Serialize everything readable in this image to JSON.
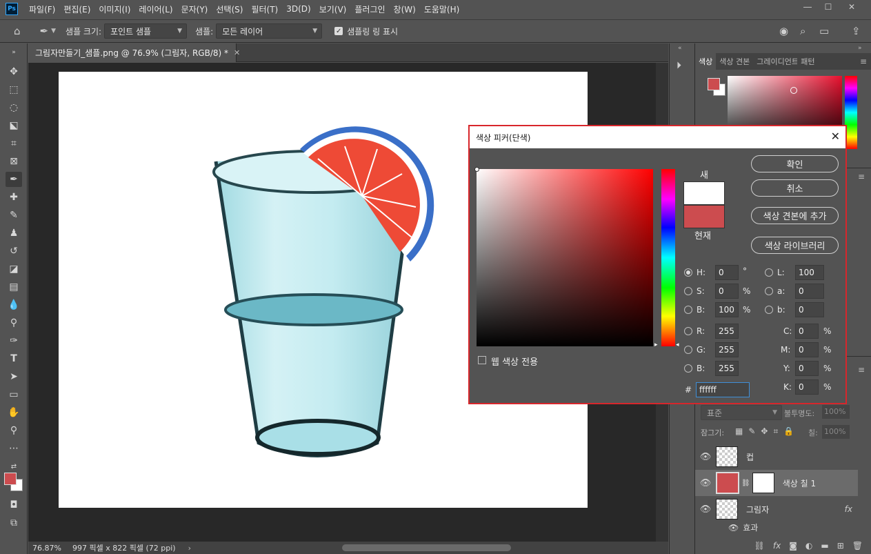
{
  "menu": {
    "logo": "Ps",
    "items": [
      "파일(F)",
      "편집(E)",
      "이미지(I)",
      "레이어(L)",
      "문자(Y)",
      "선택(S)",
      "필터(T)",
      "3D(D)",
      "보기(V)",
      "플러그인",
      "창(W)",
      "도움말(H)"
    ]
  },
  "options": {
    "sample_size_label": "샘플 크기:",
    "sample_size_value": "포인트 샘플",
    "sample_label": "샘플:",
    "sample_value": "모든 레이어",
    "show_ring_label": "샘플링 링 표시"
  },
  "document": {
    "tab_title": "그림자만들기_샘플.png @ 76.9% (그림자, RGB/8) *",
    "zoom": "76.87%",
    "dimensions": "997 픽셀 x 822 픽셀 (72 ppi)"
  },
  "panels": {
    "color_tabs": [
      "색상",
      "색상 견본",
      "그레이디언트",
      "패턴"
    ],
    "blend_mode": "표준",
    "opacity_label": "불투명도:",
    "opacity_value": "100%",
    "lock_label": "잠그기:",
    "fill_label": "칠:",
    "fill_value": "100%",
    "layers": [
      {
        "name": "컵"
      },
      {
        "name": "색상 칠 1"
      },
      {
        "name": "그림자"
      }
    ],
    "effects_label": "효과"
  },
  "dialog": {
    "title": "색상 피커(단색)",
    "new_label": "새",
    "current_label": "현재",
    "ok": "확인",
    "cancel": "취소",
    "add_swatch": "색상 견본에 추가",
    "color_library": "색상 라이브러리",
    "web_only": "웹 색상 전용",
    "fields": {
      "H": "0",
      "S": "0",
      "B": "100",
      "R": "255",
      "G": "255",
      "B2": "255",
      "L": "100",
      "a": "0",
      "b": "0",
      "C": "0",
      "M": "0",
      "Y": "0",
      "K": "0"
    },
    "units": {
      "deg": "°",
      "pct": "%"
    },
    "hex_label": "#",
    "hex": "ffffff",
    "new_color": "#ffffff",
    "current_color": "#cc4c4f"
  },
  "colors": {
    "foreground": "#cc4c4f",
    "background": "#ffffff",
    "dialog_border": "#d8262b"
  }
}
